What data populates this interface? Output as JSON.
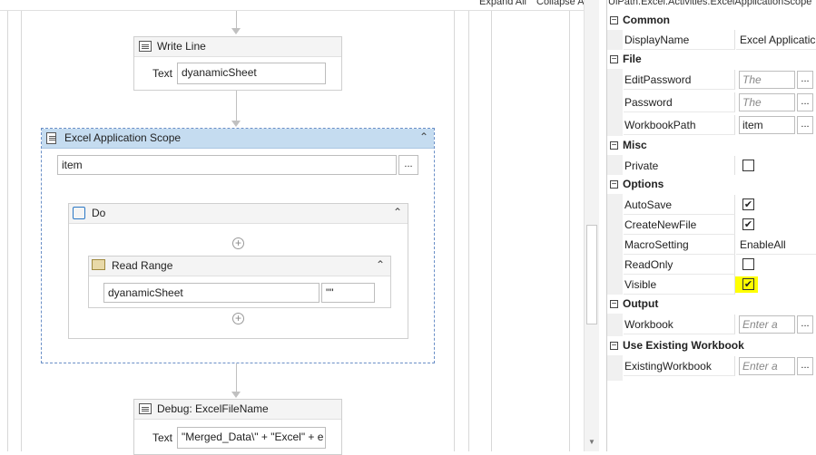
{
  "canvas": {
    "expand_all": "Expand All",
    "collapse_all": "Collapse All",
    "write_line": {
      "title": "Write Line",
      "text_label": "Text",
      "text_value": "dyanamicSheet"
    },
    "scope": {
      "title": "Excel Application Scope",
      "path_value": "item",
      "browse_label": "...",
      "do": {
        "title": "Do",
        "read_range": {
          "title": "Read Range",
          "sheet_value": "dyanamicSheet",
          "range_value": "\"\""
        }
      }
    },
    "debug": {
      "title": "Debug: ExcelFileName",
      "text_label": "Text",
      "text_value": "\"Merged_Data\\\" + \"Excel\" + e"
    }
  },
  "properties": {
    "type_name": "UiPath.Excel.Activities.ExcelApplicationScope",
    "categories": {
      "common": "Common",
      "file": "File",
      "misc": "Misc",
      "options": "Options",
      "output": "Output",
      "use_existing": "Use Existing Workbook"
    },
    "display_name": {
      "label": "DisplayName",
      "value": "Excel Applicatic"
    },
    "edit_password": {
      "label": "EditPassword",
      "placeholder": "The passw"
    },
    "password": {
      "label": "Password",
      "placeholder": "The passw"
    },
    "workbook_path": {
      "label": "WorkbookPath",
      "value": "item"
    },
    "private": {
      "label": "Private",
      "checked": false
    },
    "auto_save": {
      "label": "AutoSave",
      "checked": true
    },
    "create_new_file": {
      "label": "CreateNewFile",
      "checked": true
    },
    "macro_setting": {
      "label": "MacroSetting",
      "value": "EnableAll"
    },
    "read_only": {
      "label": "ReadOnly",
      "checked": false
    },
    "visible": {
      "label": "Visible",
      "checked": true,
      "highlight": "#ffff00"
    },
    "workbook": {
      "label": "Workbook",
      "placeholder": "Enter a VB"
    },
    "existing_workbook": {
      "label": "ExistingWorkbook",
      "placeholder": "Enter a VB"
    },
    "ellipsis": "...",
    "collapse_glyph": "−",
    "check_glyph": "✔"
  }
}
